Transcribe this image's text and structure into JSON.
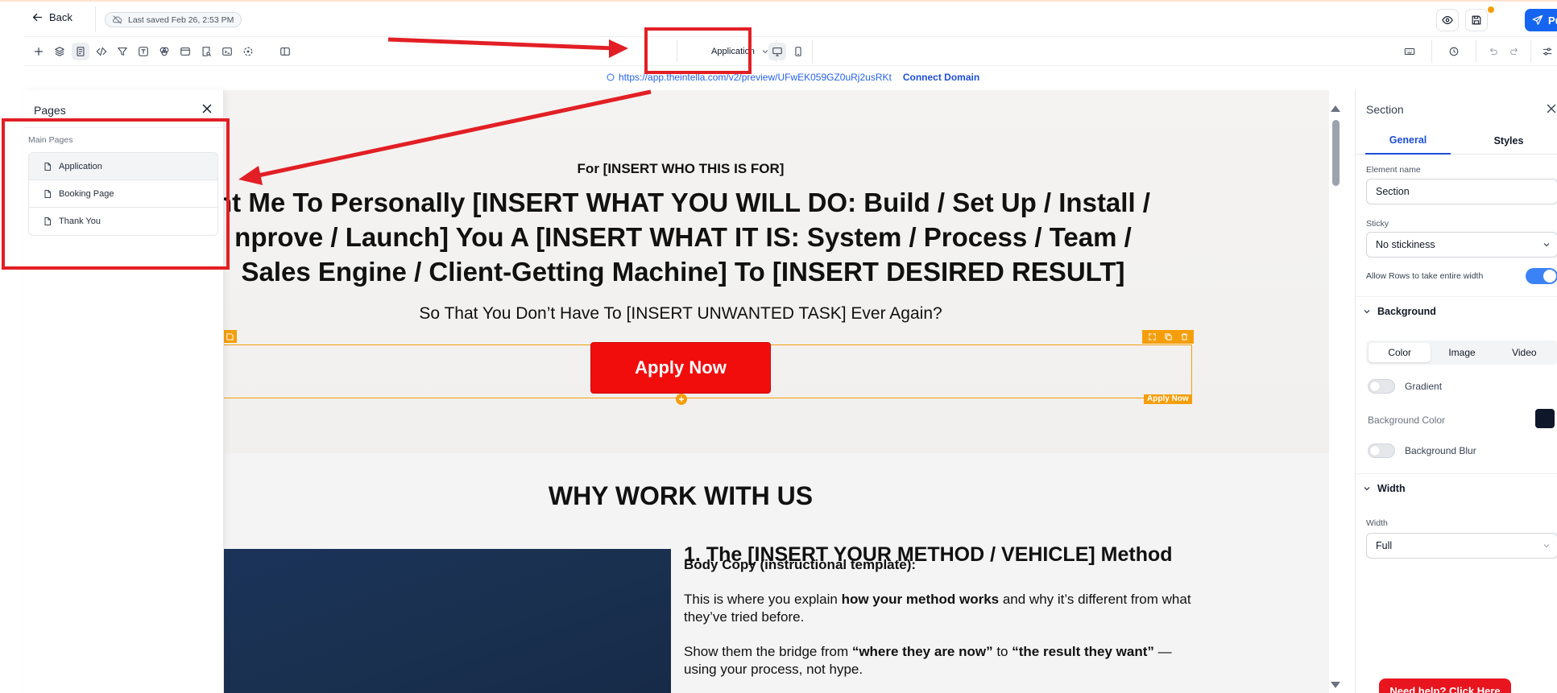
{
  "topbar": {
    "back_label": "Back",
    "saved_status": "Last saved Feb 26, 2:53 PM",
    "publish_label": "Publish"
  },
  "toolbar": {
    "page_select_value": "Application"
  },
  "urlbar": {
    "url": "https://app.theintella.com/v2/preview/UFwEK059GZ0uRj2usRKt",
    "connect_label": "Connect Domain"
  },
  "canvas": {
    "hero_subheading": "For [INSERT WHO THIS IS FOR]",
    "hero_headline_lines": [
      "nt Me To Personally [INSERT WHAT YOU WILL DO: Build / Set Up / Install /",
      "nprove / Launch] You A [INSERT WHAT IT IS: System / Process / Team /",
      "Sales Engine / Client-Getting Machine] To [INSERT DESIRED RESULT]"
    ],
    "hero_tagline": "So That You Don’t Have To [INSERT UNWANTED TASK] Ever Again?",
    "cta_label": "Apply Now",
    "selection_label": "Apply Now",
    "why_title": "WHY WORK WITH US",
    "method_title": "1. The [INSERT YOUR METHOD / VEHICLE] Method",
    "body_copy_label": "Body Copy (instructional template):",
    "para1": {
      "a": "This is where you explain ",
      "b": "how your method works",
      "c": " and why it’s different from what they’ve tried before."
    },
    "para2": {
      "a": "Show them the bridge from ",
      "b": "“where they are now”",
      "c": " to ",
      "d": "“the result they want”",
      "e": " — using your process, not hype."
    }
  },
  "pages_panel": {
    "title": "Pages",
    "group_label": "Main Pages",
    "pages": [
      "Application",
      "Booking Page",
      "Thank You"
    ],
    "active_index": 0
  },
  "properties": {
    "title": "Section",
    "tabs": [
      "General",
      "Styles"
    ],
    "active_tab": "General",
    "element_name_label": "Element name",
    "element_name_value": "Section",
    "sticky_label": "Sticky",
    "sticky_value": "No stickiness",
    "allow_rows_label": "Allow Rows to take entire width",
    "allow_rows_on": true,
    "background_section": "Background",
    "background_tabs": [
      "Color",
      "Image",
      "Video"
    ],
    "background_active_tab": "Color",
    "gradient_label": "Gradient",
    "bg_color_label": "Background Color",
    "bg_color_value": "#0f172a",
    "bg_blur_label": "Background Blur",
    "width_section": "Width",
    "width_label": "Width",
    "width_value": "Full",
    "help_label": "Need help? Click Here"
  },
  "colors": {
    "accent_blue": "#1565f0",
    "cta_red": "#f20d0d",
    "selection_orange": "#f59e0b",
    "annotation_red": "#e21f25"
  },
  "icons": {
    "back": "arrow-left-icon",
    "cloud": "cloud-off-icon",
    "preview": "eye-icon",
    "save": "save-icon",
    "publish": "send-icon",
    "page": "file-icon"
  }
}
